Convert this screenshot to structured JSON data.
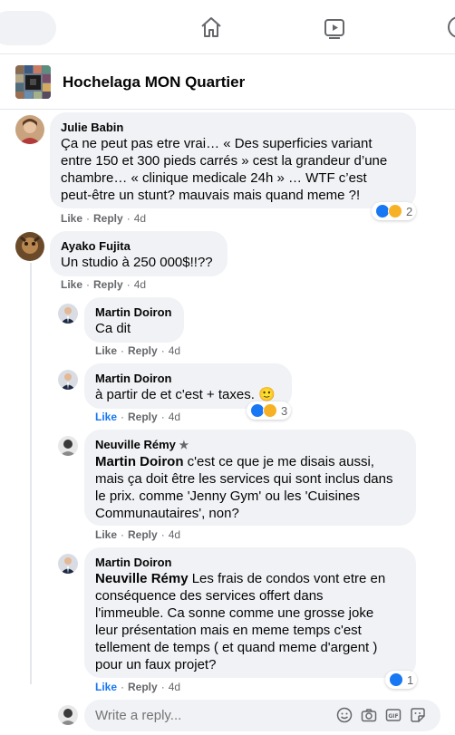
{
  "group": {
    "title": "Hochelaga MON Quartier"
  },
  "nav": {
    "icons": [
      "home-icon",
      "watch-icon",
      "groups-icon"
    ]
  },
  "comments": [
    {
      "author": "Julie Babin",
      "text_lines": [
        "Ça ne peut pas etre vrai… « Des superficies variant",
        "entre 150 et 300 pieds carrés » cest la grandeur d’une",
        "chambre… « clinique medicale 24h » … WTF c’est",
        "peut-être un stunt? mauvais mais quand meme ?!"
      ],
      "like": "Like",
      "reply": "Reply",
      "time": "4d",
      "reaction_count": "2"
    },
    {
      "author": "Ayako Fujita",
      "text_lines": [
        "Un studio à 250 000$!!??"
      ],
      "like": "Like",
      "reply": "Reply",
      "time": "4d"
    }
  ],
  "replies": [
    {
      "author": "Martin Doiron",
      "text_lines": [
        "Ca dit"
      ],
      "like": "Like",
      "reply": "Reply",
      "time": "4d"
    },
    {
      "author": "Martin Doiron",
      "text_lines": [
        "à partir de et c'est + taxes. 🙂"
      ],
      "like": "Like",
      "reply": "Reply",
      "time": "4d",
      "reaction_count": "3"
    },
    {
      "author": "Neuville Rémy",
      "mention": "Martin Doiron",
      "text_lines": [
        " c'est ce que je me disais aussi,",
        "mais ça doit être les services qui sont inclus dans",
        "le prix. comme 'Jenny Gym' ou les 'Cuisines",
        "Communautaires', non?"
      ],
      "like": "Like",
      "reply": "Reply",
      "time": "4d"
    },
    {
      "author": "Martin Doiron",
      "mention": "Neuville Rémy",
      "text_lines": [
        " Les frais de condos vont etre en",
        "conséquence des services offert dans",
        "l'immeuble. Ca sonne comme une grosse joke",
        "leur présentation mais en meme temps c'est",
        "tellement de temps ( et quand meme d'argent )",
        "pour un faux projet?"
      ],
      "like": "Like",
      "reply": "Reply",
      "time": "4d",
      "reaction_count": "1"
    }
  ],
  "reply_box": {
    "placeholder": "Write a reply..."
  }
}
